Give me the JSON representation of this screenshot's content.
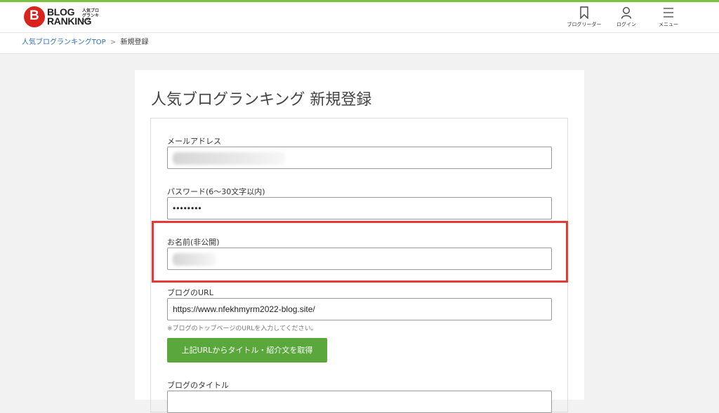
{
  "header": {
    "logo_main_line1": "BLOG",
    "logo_main_line2": "RANKING",
    "logo_sub": "人気ブログランキング",
    "nav": [
      {
        "label": "ブログリーダー",
        "icon": "bookmark-icon"
      },
      {
        "label": "ログイン",
        "icon": "user-icon"
      },
      {
        "label": "メニュー",
        "icon": "hamburger-menu-icon"
      }
    ]
  },
  "breadcrumb": {
    "home": "人気ブログランキングTOP",
    "separator": ">",
    "current": "新規登録"
  },
  "page": {
    "title": "人気ブログランキング 新規登録"
  },
  "form": {
    "email": {
      "label": "メールアドレス",
      "value": ""
    },
    "password": {
      "label": "パスワード(6〜30文字以内)",
      "value": "••••••••"
    },
    "name": {
      "label": "お名前(非公開)",
      "value": ""
    },
    "blog_url": {
      "label": "ブログのURL",
      "value": "https://www.nfekhmyrm2022-blog.site/",
      "hint": "※ブログのトップページのURLを入力してください。"
    },
    "fetch_button": "上記URLからタイトル・紹介文を取得",
    "blog_title": {
      "label": "ブログのタイトル"
    }
  },
  "colors": {
    "accent_green": "#7bc142",
    "button_green": "#5aa83c",
    "link_blue": "#2a6fb5",
    "highlight_red": "#e53935",
    "logo_red": "#d9231d"
  }
}
